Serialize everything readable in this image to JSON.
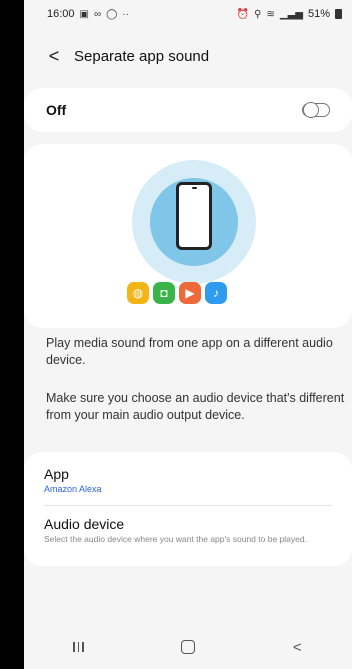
{
  "status_bar": {
    "time": "16:00",
    "left_icons": [
      "gallery-icon",
      "voicemail-icon",
      "circle-icon",
      "more-dots-icon"
    ],
    "more_dots": "··",
    "battery": "51%"
  },
  "header": {
    "title": "Separate app sound"
  },
  "toggle_row": {
    "label": "Off",
    "state": "off"
  },
  "illustration": {
    "colors": {
      "halo_outer": "#d6edf8",
      "halo_inner": "#7fc6e8",
      "internet": "#f2b515",
      "game": "#3ab44a",
      "video": "#ee6a3a",
      "music": "#2e9bf0"
    },
    "app_icons": [
      "internet-icon",
      "game-controller-icon",
      "play-video-icon",
      "music-note-icon"
    ]
  },
  "description": {
    "para1": "Play media sound from one app on a different audio device.",
    "para2": "Make sure you choose an audio device that's different from your main audio output device."
  },
  "settings": {
    "app": {
      "title": "App",
      "value": "Amazon Alexa"
    },
    "audio_device": {
      "title": "Audio device",
      "subtitle": "Select the audio device where you want the app's sound to be played."
    }
  },
  "nav_bar": {
    "buttons": [
      "recent-apps",
      "home",
      "back"
    ]
  }
}
